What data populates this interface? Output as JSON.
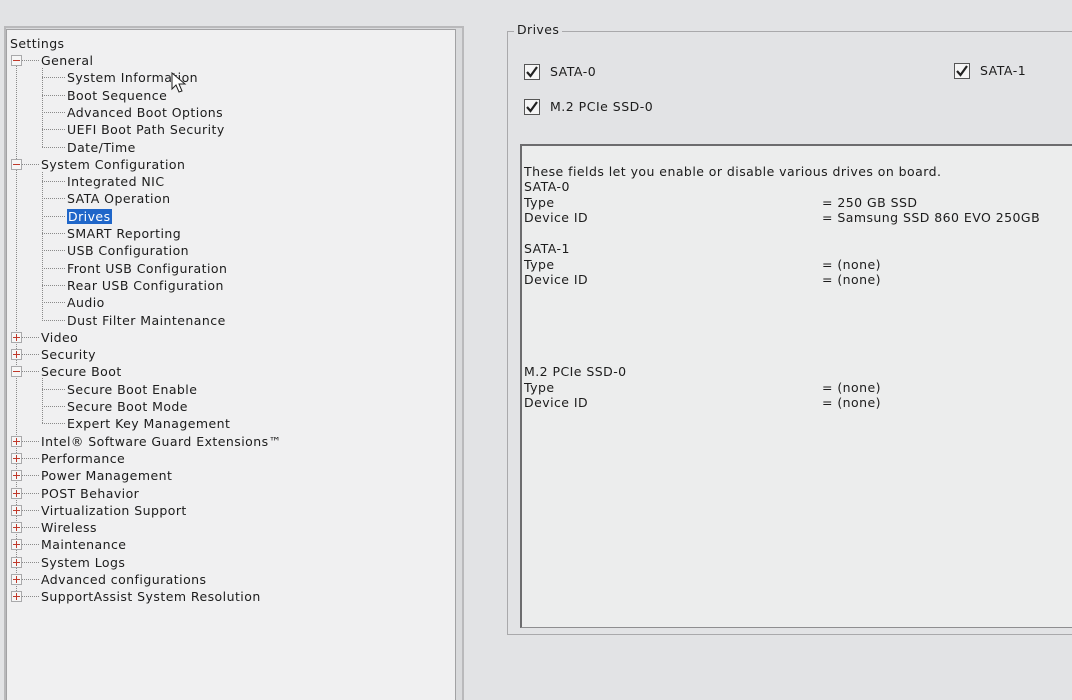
{
  "tree": {
    "root": "Settings",
    "items": [
      {
        "label": "General",
        "expander": "minus"
      },
      {
        "label": "System Information"
      },
      {
        "label": "Boot Sequence"
      },
      {
        "label": "Advanced Boot Options"
      },
      {
        "label": "UEFI Boot Path Security"
      },
      {
        "label": "Date/Time"
      },
      {
        "label": "System Configuration",
        "expander": "minus"
      },
      {
        "label": "Integrated NIC"
      },
      {
        "label": "SATA Operation"
      },
      {
        "label": "Drives",
        "selected": true
      },
      {
        "label": "SMART Reporting"
      },
      {
        "label": "USB Configuration"
      },
      {
        "label": "Front USB Configuration"
      },
      {
        "label": "Rear USB Configuration"
      },
      {
        "label": "Audio"
      },
      {
        "label": "Dust Filter Maintenance"
      },
      {
        "label": "Video",
        "expander": "plus"
      },
      {
        "label": "Security",
        "expander": "plus"
      },
      {
        "label": "Secure Boot",
        "expander": "minus"
      },
      {
        "label": "Secure Boot Enable"
      },
      {
        "label": "Secure Boot Mode"
      },
      {
        "label": "Expert Key Management"
      },
      {
        "label": "Intel® Software Guard Extensions™",
        "expander": "plus"
      },
      {
        "label": "Performance",
        "expander": "plus"
      },
      {
        "label": "Power Management",
        "expander": "plus"
      },
      {
        "label": "POST Behavior",
        "expander": "plus"
      },
      {
        "label": "Virtualization Support",
        "expander": "plus"
      },
      {
        "label": "Wireless",
        "expander": "plus"
      },
      {
        "label": "Maintenance",
        "expander": "plus"
      },
      {
        "label": "System Logs",
        "expander": "plus"
      },
      {
        "label": "Advanced configurations",
        "expander": "plus"
      },
      {
        "label": "SupportAssist System Resolution",
        "expander": "plus"
      }
    ]
  },
  "drives": {
    "title": "Drives",
    "checkboxes": [
      {
        "label": "SATA-0",
        "checked": true
      },
      {
        "label": "SATA-1",
        "checked": true
      },
      {
        "label": "M.2 PCIe SSD-0",
        "checked": true
      }
    ],
    "info": {
      "description": "These fields let you enable or disable various drives on board.",
      "sata0": {
        "heading": "SATA-0",
        "type_label": "Type",
        "type_value": "= 250 GB SSD",
        "device_label": "Device ID",
        "device_value": "= Samsung SSD 860 EVO 250GB"
      },
      "sata1": {
        "heading": "SATA-1",
        "type_label": "Type",
        "type_value": "= (none)",
        "device_label": "Device ID",
        "device_value": "= (none)"
      },
      "m2": {
        "heading": "M.2 PCIe SSD-0",
        "type_label": "Type",
        "type_value": "= (none)",
        "device_label": "Device ID",
        "device_value": "= (none)"
      }
    }
  },
  "colors": {
    "selection": "#1f66c9",
    "expander": "#c0392b"
  }
}
